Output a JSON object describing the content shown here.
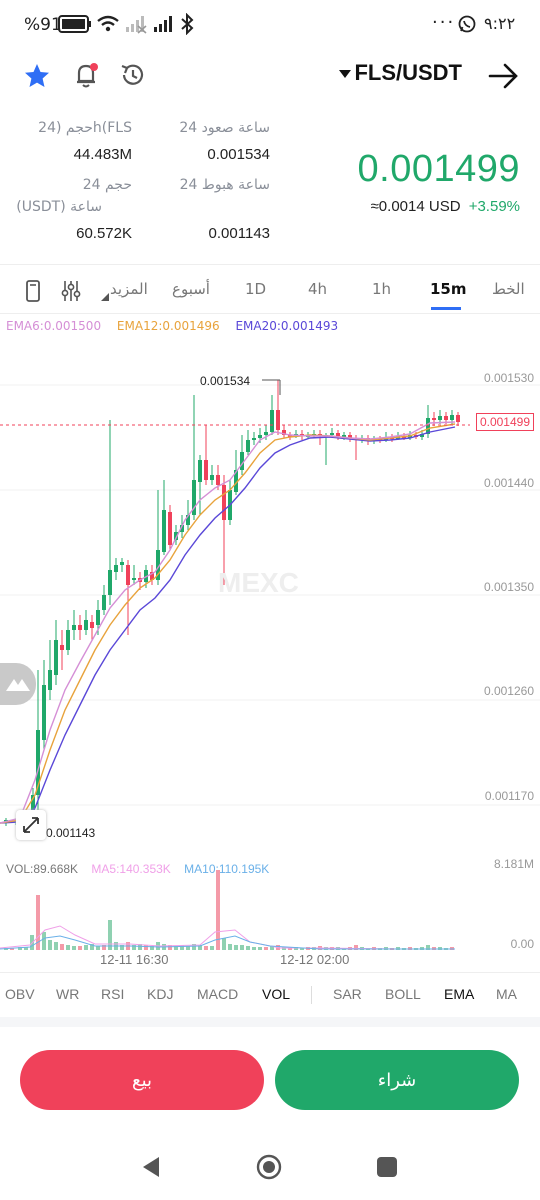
{
  "status": {
    "battery": "%91",
    "time": "٩:٢٢"
  },
  "header": {
    "pair": "FLS/USDT"
  },
  "stats": {
    "vol_fls_label": "حجم (24h(FLS",
    "vol_fls_value": "44.483M",
    "high_label": "24 ساعة صعود",
    "high_value": "0.001534",
    "vol_usdt_label_1": "حجم 24",
    "vol_usdt_label_2": "(USDT) ساعة",
    "vol_usdt_value": "60.572K",
    "low_label": "24 ساعة هبوط",
    "low_value": "0.001143",
    "last_price": "0.001499",
    "usd_price": "≈0.0014 USD",
    "change": "+3.59%"
  },
  "tabs": [
    "الخط",
    "15m",
    "1h",
    "4h",
    "1D",
    "أسبوع",
    "المزيد"
  ],
  "active_tab": "15m",
  "ema": {
    "ema6": "EMA6:0.001500",
    "ema12": "EMA12:0.001496",
    "ema20": "EMA20:0.001493"
  },
  "chart": {
    "y_labels": [
      "0.001530",
      "0.001440",
      "0.001350",
      "0.001260",
      "0.001170"
    ],
    "max_label": "0.001534",
    "min_label": "0.001143",
    "current_price_tag": "0.001499",
    "watermark": "MEXC",
    "x_labels": [
      "12-11 16:30",
      "12-12 02:00"
    ]
  },
  "volume": {
    "vol": "VOL:89.668K",
    "ma5": "MA5:140.353K",
    "ma10": "MA10:110.195K",
    "top_label": "8.181M",
    "zero_label": "0.00"
  },
  "indicators": [
    "OBV",
    "WR",
    "RSI",
    "KDJ",
    "MACD",
    "VOL",
    "SAR",
    "BOLL",
    "EMA",
    "MA"
  ],
  "actions": {
    "sell": "بيع",
    "buy": "شراء"
  },
  "colors": {
    "up": "#20a86a",
    "down": "#f0415a",
    "ema6": "#d58fd6",
    "ema12": "#e8a33c",
    "ema20": "#5a48d8"
  }
}
